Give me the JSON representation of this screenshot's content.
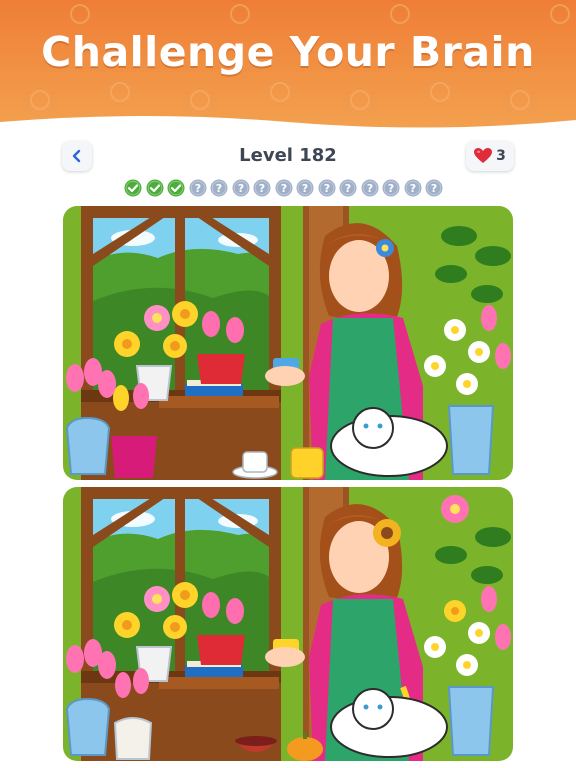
{
  "banner": {
    "title": "Challenge Your Brain"
  },
  "header": {
    "back_icon": "chevron-left-icon",
    "level_label": "Level 182",
    "lives_icon": "heart-icon",
    "lives_count": "3"
  },
  "progress": {
    "total": 15,
    "found": 3,
    "found_icon": "check-icon",
    "remaining_icon": "question-icon"
  },
  "panels": [
    "original-image",
    "modified-image"
  ],
  "colors": {
    "banner_top": "#ee7e36",
    "banner_bottom": "#f3a14f",
    "found_dot": "#4cae3a",
    "remaining_dot": "#9fb0c8",
    "heart": "#e02b3a",
    "wall": "#7bb42a"
  }
}
